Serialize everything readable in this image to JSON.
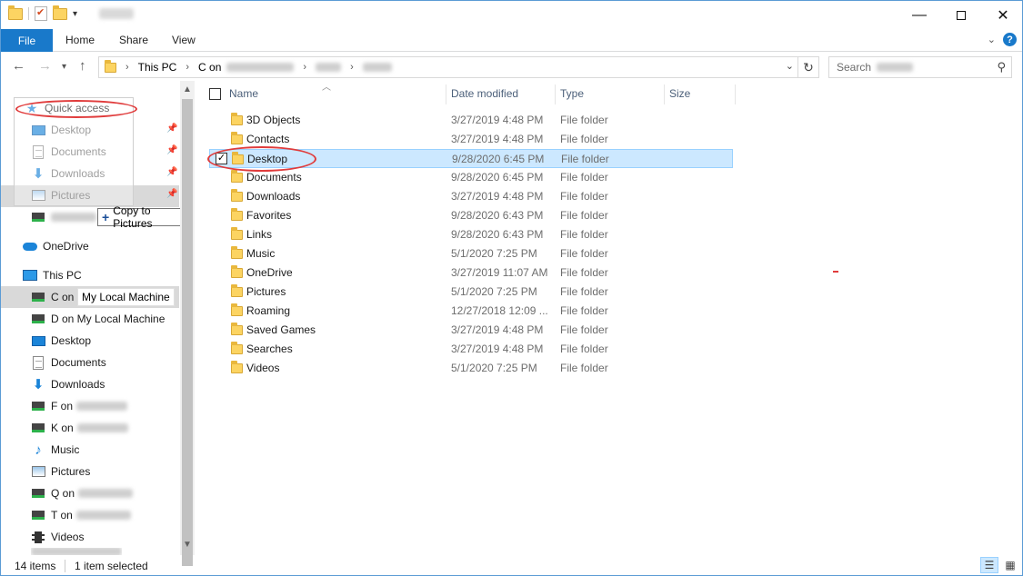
{
  "colors": {
    "accent": "#1979ca",
    "selection": "#cce8ff",
    "annotation": "#e03c3c"
  },
  "titlebar": {
    "qat_icons": [
      "folder-icon",
      "properties-icon",
      "new-folder-icon",
      "customize-qat-icon"
    ],
    "title": "Robert",
    "minimize": "—",
    "maximize": "☐",
    "close": "✕"
  },
  "ribbon": {
    "tabs": [
      "File",
      "Home",
      "Share",
      "View"
    ],
    "help": "?"
  },
  "address": {
    "breadcrumbs": [
      "This PC",
      "C on",
      "Users",
      "Robert"
    ],
    "search_placeholder": "Search"
  },
  "nav_pane": {
    "items": [
      {
        "label": "Quick access",
        "icon": "star-icon"
      },
      {
        "label": "Desktop",
        "icon": "desktop-icon",
        "pinned": true
      },
      {
        "label": "Documents",
        "icon": "documents-icon",
        "pinned": true
      },
      {
        "label": "Downloads",
        "icon": "downloads-icon",
        "pinned": true
      },
      {
        "label": "Pictures",
        "icon": "pictures-icon",
        "pinned": true
      },
      {
        "label": "OneDrive",
        "icon": "cloud-icon"
      },
      {
        "label": "This PC",
        "icon": "pc-icon"
      },
      {
        "label": "C on",
        "icon": "network-drive-icon"
      },
      {
        "label": "D on My Local Machine",
        "icon": "network-drive-icon"
      },
      {
        "label": "Desktop",
        "icon": "desktop-icon"
      },
      {
        "label": "Documents",
        "icon": "documents-icon"
      },
      {
        "label": "Downloads",
        "icon": "downloads-icon"
      },
      {
        "label": "F on",
        "icon": "network-drive-icon"
      },
      {
        "label": "K on",
        "icon": "network-drive-icon"
      },
      {
        "label": "Music",
        "icon": "music-icon"
      },
      {
        "label": "Pictures",
        "icon": "pictures-icon"
      },
      {
        "label": "Q on",
        "icon": "network-drive-icon"
      },
      {
        "label": "T on",
        "icon": "network-drive-icon"
      },
      {
        "label": "Videos",
        "icon": "videos-icon"
      }
    ],
    "drag_tooltip": "Copy to Pictures",
    "hover_tooltip": "My Local Machine"
  },
  "columns": {
    "name": "Name",
    "date": "Date modified",
    "type": "Type",
    "size": "Size"
  },
  "files": [
    {
      "name": "3D Objects",
      "date": "3/27/2019 4:48 PM",
      "type": "File folder"
    },
    {
      "name": "Contacts",
      "date": "3/27/2019 4:48 PM",
      "type": "File folder"
    },
    {
      "name": "Desktop",
      "date": "9/28/2020 6:45 PM",
      "type": "File folder",
      "selected": true
    },
    {
      "name": "Documents",
      "date": "9/28/2020 6:45 PM",
      "type": "File folder"
    },
    {
      "name": "Downloads",
      "date": "3/27/2019 4:48 PM",
      "type": "File folder"
    },
    {
      "name": "Favorites",
      "date": "9/28/2020 6:43 PM",
      "type": "File folder"
    },
    {
      "name": "Links",
      "date": "9/28/2020 6:43 PM",
      "type": "File folder"
    },
    {
      "name": "Music",
      "date": "5/1/2020 7:25 PM",
      "type": "File folder"
    },
    {
      "name": "OneDrive",
      "date": "3/27/2019 11:07 AM",
      "type": "File folder"
    },
    {
      "name": "Pictures",
      "date": "5/1/2020 7:25 PM",
      "type": "File folder"
    },
    {
      "name": "Roaming",
      "date": "12/27/2018 12:09 ...",
      "type": "File folder"
    },
    {
      "name": "Saved Games",
      "date": "3/27/2019 4:48 PM",
      "type": "File folder"
    },
    {
      "name": "Searches",
      "date": "3/27/2019 4:48 PM",
      "type": "File folder"
    },
    {
      "name": "Videos",
      "date": "5/1/2020 7:25 PM",
      "type": "File folder"
    }
  ],
  "status": {
    "item_count": "14 items",
    "selected": "1 item selected"
  }
}
